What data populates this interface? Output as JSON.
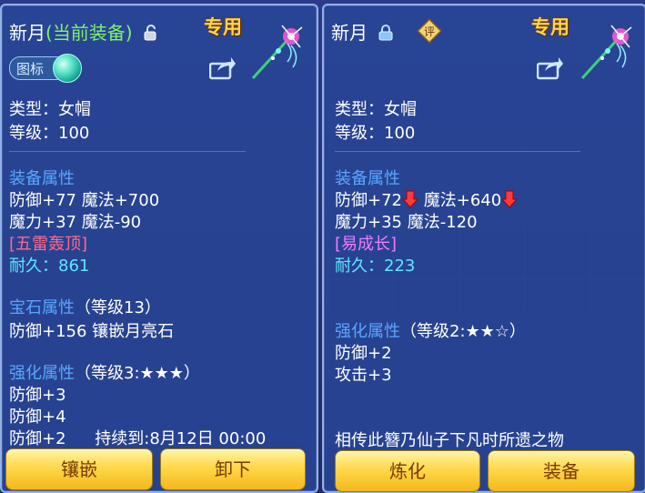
{
  "left": {
    "name": "新月",
    "equipped_tag": "(当前装备)",
    "exclusive": "专用",
    "icon_toggle_label": "图标",
    "type_line": "类型：女帽",
    "level_line": "等级：100",
    "equip_attr_title": "装备属性",
    "attr_line1": "防御+77 魔法+700",
    "attr_line2": "魔力+37 魔法-90",
    "special": "[五雷轰顶]",
    "durability_label": "耐久：",
    "durability_value": "861",
    "gem_title": "宝石属性",
    "gem_level": "（等级13）",
    "gem_line": "防御+156 镶嵌月亮石",
    "enhance_title": "强化属性",
    "enhance_level": "（等级3:★★★）",
    "enhance_line1": "防御+3",
    "enhance_line2": "防御+4",
    "enhance_line3": "防御+2",
    "duration": "持续到:8月12日 00:00",
    "btn_inlay": "镶嵌",
    "btn_unequip": "卸下"
  },
  "right": {
    "name": "新月",
    "ping": "评",
    "exclusive": "专用",
    "type_line": "类型：女帽",
    "level_line": "等级：100",
    "equip_attr_title": "装备属性",
    "attr_a": "防御+72",
    "attr_b": "魔法+640",
    "attr_line2": "魔力+35 魔法-120",
    "special": "[易成长]",
    "durability_label": "耐久：",
    "durability_value": "223",
    "enhance_title": "强化属性",
    "enhance_level": "（等级2:★★☆）",
    "enhance_line1": "防御+2",
    "enhance_line2": "攻击+3",
    "lore": "相传此簪乃仙子下凡时所遗之物",
    "btn_refine": "炼化",
    "btn_equip": "装备"
  },
  "colors": {
    "section": "#5aa6ff",
    "equipped": "#7df26a",
    "exclusive": "#ffd54a",
    "red_special": "#ff6a8a",
    "magenta_special": "#f07cff",
    "durability": "#5ee8ff",
    "button": "#ffd84a"
  },
  "icons": [
    "unlock-icon",
    "lock-icon",
    "hairpin-icon",
    "share-icon",
    "ping-badge-icon",
    "arrow-down-icon",
    "icon-toggle-orb"
  ]
}
